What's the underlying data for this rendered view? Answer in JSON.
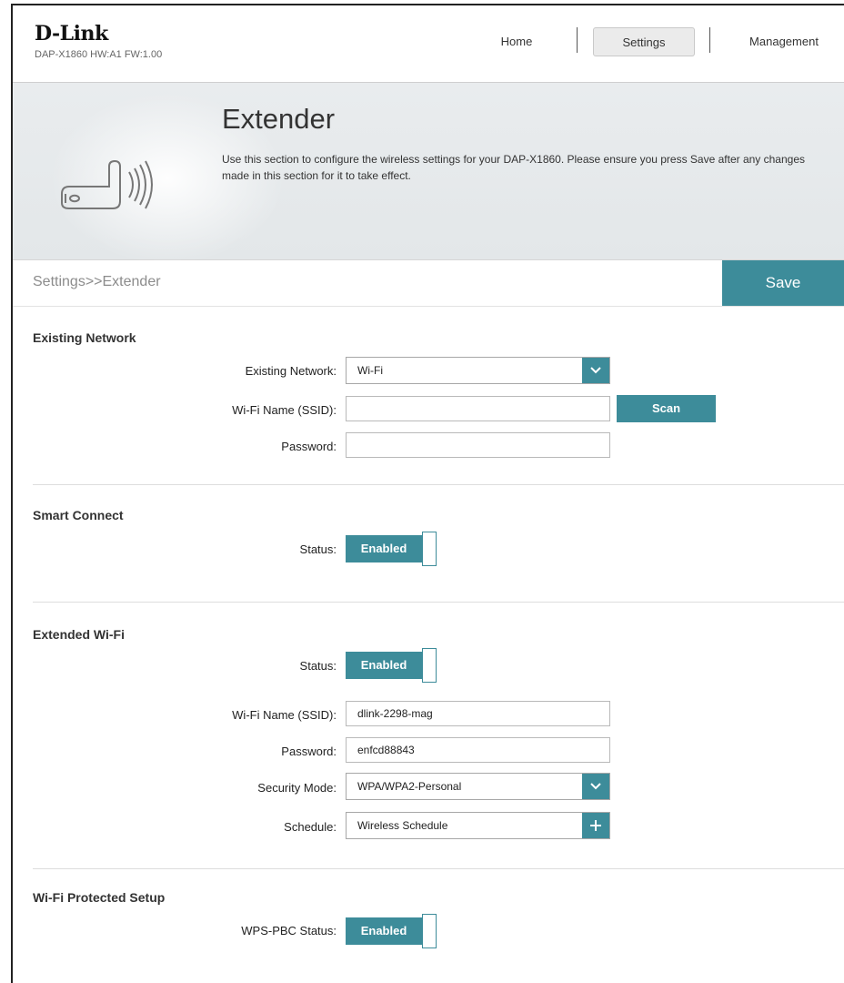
{
  "header": {
    "brand": "D-Link",
    "model_info": "DAP-X1860 HW:A1 FW:1.00",
    "nav": [
      "Home",
      "Settings",
      "Management"
    ]
  },
  "banner": {
    "title": "Extender",
    "description": "Use this section to configure the wireless settings for your DAP-X1860. Please ensure you press Save after any changes made in this section for it to take effect.",
    "icon": "extender-wireless-icon"
  },
  "breadcrumb": "Settings>>Extender",
  "save_label": "Save",
  "existing_network": {
    "title": "Existing Network",
    "network_label": "Existing Network:",
    "network_value": "Wi-Fi",
    "ssid_label": "Wi-Fi Name (SSID):",
    "ssid_value": "",
    "scan_label": "Scan",
    "password_label": "Password:",
    "password_value": ""
  },
  "smart_connect": {
    "title": "Smart Connect",
    "status_label": "Status:",
    "status_value": "Enabled"
  },
  "extended_wifi": {
    "title": "Extended Wi-Fi",
    "status_label": "Status:",
    "status_value": "Enabled",
    "ssid_label": "Wi-Fi Name (SSID):",
    "ssid_value": "dlink-2298-mag",
    "password_label": "Password:",
    "password_value": "enfcd88843",
    "security_label": "Security Mode:",
    "security_value": "WPA/WPA2-Personal",
    "schedule_label": "Schedule:",
    "schedule_value": "Wireless Schedule"
  },
  "wps": {
    "title": "Wi-Fi Protected Setup",
    "status_label": "WPS-PBC Status:",
    "status_value": "Enabled"
  },
  "colors": {
    "accent": "#3d8c9a",
    "banner_bg": "#e6e9eb"
  }
}
